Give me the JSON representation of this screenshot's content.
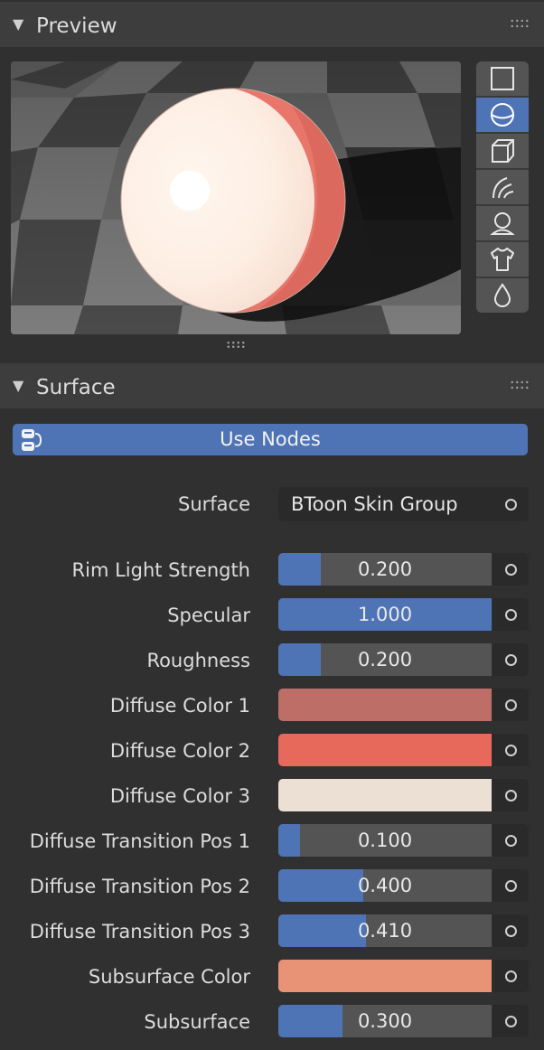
{
  "preview": {
    "title": "Preview",
    "collapse_icon": "triangle-down",
    "preview_types": [
      {
        "name": "flat-preview-icon",
        "active": false
      },
      {
        "name": "sphere-preview-icon",
        "active": true
      },
      {
        "name": "cube-preview-icon",
        "active": false
      },
      {
        "name": "hair-preview-icon",
        "active": false
      },
      {
        "name": "monkey-preview-icon",
        "active": false
      },
      {
        "name": "cloth-preview-icon",
        "active": false
      },
      {
        "name": "fluid-preview-icon",
        "active": false
      }
    ]
  },
  "surface": {
    "title": "Surface",
    "use_nodes_label": "Use Nodes",
    "surface_label": "Surface",
    "surface_value": "BToon Skin Group",
    "accent": "#4f74b5",
    "inputs": [
      {
        "label": "Rim Light Strength",
        "kind": "value",
        "value": "0.200",
        "fraction": 0.2
      },
      {
        "label": "Specular",
        "kind": "value",
        "value": "1.000",
        "fraction": 1.0
      },
      {
        "label": "Roughness",
        "kind": "value",
        "value": "0.200",
        "fraction": 0.2
      },
      {
        "label": "Diffuse Color 1",
        "kind": "color",
        "color": "#bc6e67"
      },
      {
        "label": "Diffuse Color 2",
        "kind": "color",
        "color": "#e6695c"
      },
      {
        "label": "Diffuse Color 3",
        "kind": "color",
        "color": "#ecdfd3"
      },
      {
        "label": "Diffuse Transition Pos 1",
        "kind": "value",
        "value": "0.100",
        "fraction": 0.1
      },
      {
        "label": "Diffuse Transition Pos 2",
        "kind": "value",
        "value": "0.400",
        "fraction": 0.4
      },
      {
        "label": "Diffuse Transition Pos 3",
        "kind": "value",
        "value": "0.410",
        "fraction": 0.41
      },
      {
        "label": "Subsurface Color",
        "kind": "color",
        "color": "#e99376"
      },
      {
        "label": "Subsurface",
        "kind": "value",
        "value": "0.300",
        "fraction": 0.3
      }
    ]
  }
}
